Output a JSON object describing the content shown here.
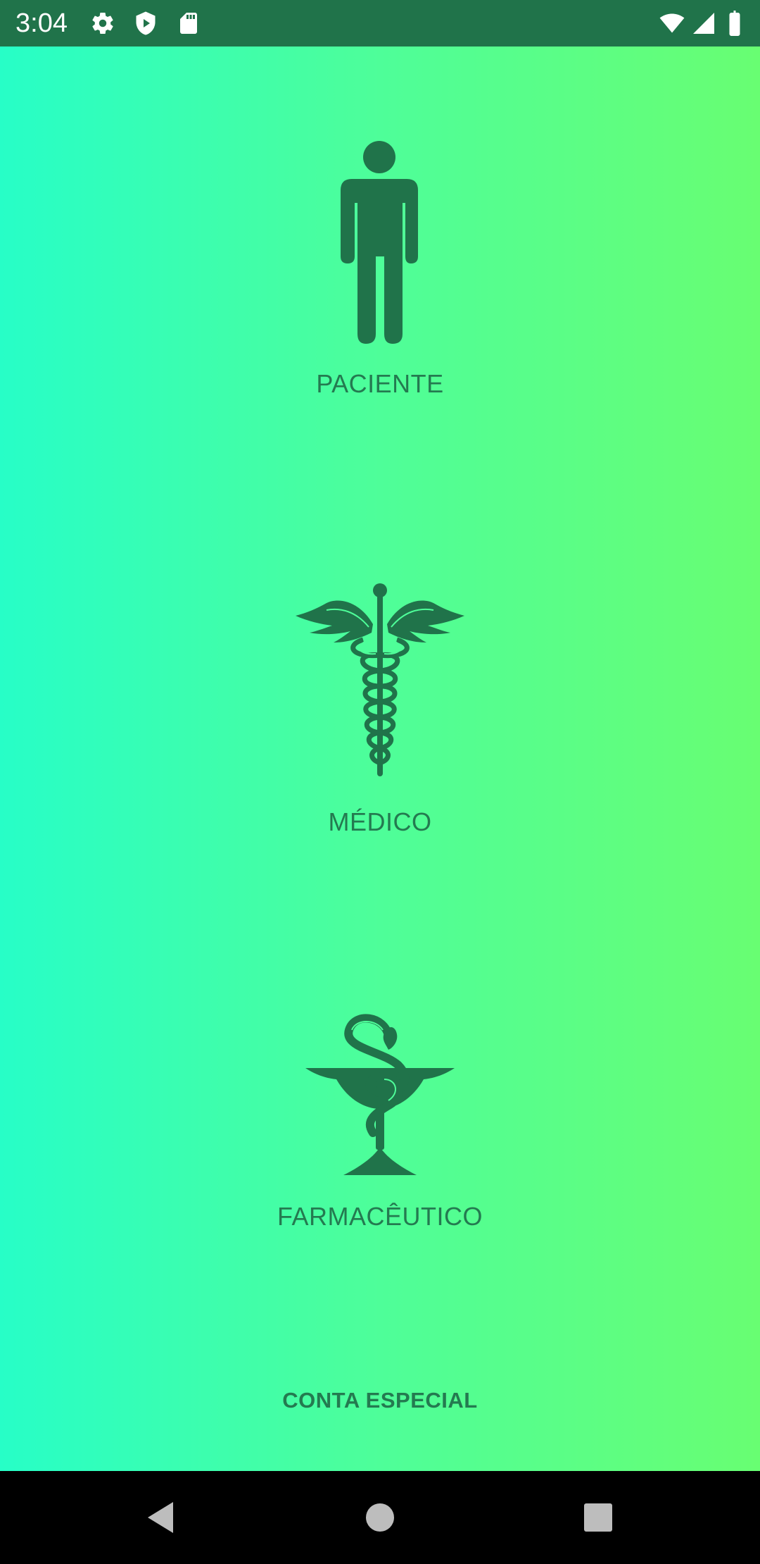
{
  "status_bar": {
    "time": "3:04",
    "left_icons": [
      "settings-icon",
      "shield-play-icon",
      "sd-card-icon"
    ],
    "right_icons": [
      "wifi-icon",
      "signal-icon",
      "battery-icon"
    ]
  },
  "roles": [
    {
      "label": "PACIENTE",
      "icon": "person-icon"
    },
    {
      "label": "MÉDICO",
      "icon": "caduceus-icon"
    },
    {
      "label": "FARMACÊUTICO",
      "icon": "bowl-of-hygieia-icon"
    }
  ],
  "special_account": {
    "label": "CONTA ESPECIAL"
  },
  "colors": {
    "status_bar": "#20734a",
    "icon_text": "#247a50",
    "gradient_start": "#27fec7",
    "gradient_end": "#68fe72"
  },
  "nav_bar": {
    "buttons": [
      "back-icon",
      "home-icon",
      "recents-icon"
    ]
  }
}
